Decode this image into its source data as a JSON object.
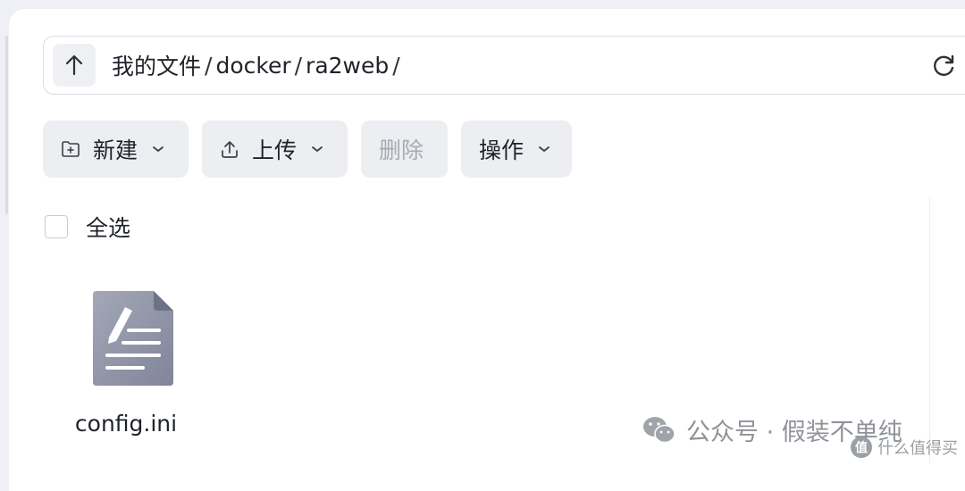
{
  "pathbar": {
    "segments": [
      "我的文件",
      "docker",
      "ra2web"
    ],
    "separator": "/"
  },
  "toolbar": {
    "new_label": "新建",
    "upload_label": "上传",
    "delete_label": "删除",
    "actions_label": "操作"
  },
  "select_all_label": "全选",
  "files": [
    {
      "name": "config.ini",
      "icon": "text-file-icon"
    }
  ],
  "watermark": {
    "text": "公众号 · 假装不单纯",
    "site": "什么值得买",
    "site_badge": "值"
  }
}
